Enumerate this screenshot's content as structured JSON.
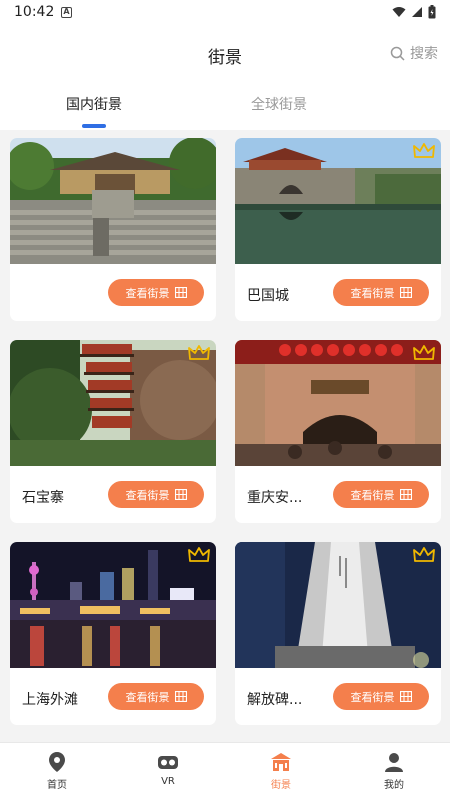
{
  "status_bar": {
    "time": "10:42",
    "sim_label": "A"
  },
  "header": {
    "title": "街景",
    "search_label": "搜索"
  },
  "tabs": [
    {
      "label": "国内街景",
      "active": true
    },
    {
      "label": "全球街景",
      "active": false
    }
  ],
  "cards": [
    {
      "name": "",
      "button_label": "查看街景",
      "crown": false
    },
    {
      "name": "巴国城",
      "button_label": "查看街景",
      "crown": true
    },
    {
      "name": "石宝寨",
      "button_label": "查看街景",
      "crown": true
    },
    {
      "name": "重庆安...",
      "button_label": "查看街景",
      "crown": true
    },
    {
      "name": "上海外滩",
      "button_label": "查看街景",
      "crown": true
    },
    {
      "name": "解放碑...",
      "button_label": "查看街景",
      "crown": true
    }
  ],
  "bottom_nav": [
    {
      "label": "首页",
      "icon": "location-pin-icon",
      "active": false
    },
    {
      "label": "VR",
      "icon": "vr-headset-icon",
      "active": false
    },
    {
      "label": "街景",
      "icon": "street-view-building-icon",
      "active": true
    },
    {
      "label": "我的",
      "icon": "person-icon",
      "active": false
    }
  ],
  "colors": {
    "accent": "#f47f4c",
    "tab_indicator": "#2f6ee4",
    "crown": "#f0b800"
  }
}
